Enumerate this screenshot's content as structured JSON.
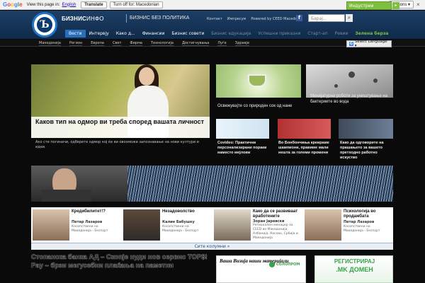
{
  "translate_bar": {
    "logo": [
      "G",
      "o",
      "o",
      "g",
      "l",
      "e"
    ],
    "prompt": "View this page in:",
    "language": "English",
    "translate_button": "Translate",
    "turn_off_button": "Turn off for: Macedonian",
    "options": "Options ▾",
    "close": "×"
  },
  "header": {
    "brand_bold": "БИЗНИС",
    "brand_thin": "ИНФО",
    "tagline": "БИЗНИС БЕЗ ПОЛИТИКА",
    "top_links": [
      "Контакт",
      "Импресум",
      "Powered by CEED Macedonia"
    ],
    "search_placeholder": "Барај...",
    "industry_label": "Индустрии",
    "industry_arrow": "▸",
    "logo_letter": "Ъ"
  },
  "nav": {
    "items": [
      {
        "label": "Вести",
        "style": "active"
      },
      {
        "label": "Интервју",
        "style": "normal"
      },
      {
        "label": "Како д...",
        "style": "normal"
      },
      {
        "label": "Финансии",
        "style": "normal"
      },
      {
        "label": "Бизнис совети",
        "style": "normal"
      },
      {
        "label": "Бизнис едукација",
        "style": "dim"
      },
      {
        "label": "Успешни приказни",
        "style": "dim"
      },
      {
        "label": "Старт-ап",
        "style": "dim"
      },
      {
        "label": "Ревии",
        "style": "dim"
      },
      {
        "label": "Зелена берза",
        "style": "green"
      }
    ]
  },
  "subnav": {
    "items": [
      "Македонија",
      "Регион",
      "Европа",
      "Свет",
      "Фирма",
      "Технологија",
      "Достигнувања",
      "Луѓе",
      "Здравје"
    ],
    "language_select": "Select Language ▾"
  },
  "hero": {
    "title": "Каков тип на одмор ви треба според вашата личност",
    "desc": "Ако сте погиначи, одберете одмор кој ќе ви овозможи запознавање на нови култури и идеи."
  },
  "articles": [
    {
      "title": "Освежувајте со природен сок од нане"
    },
    {
      "title": "Минијатурни роботи за уништување на бактериите во вода"
    },
    {
      "title": "Covideo: Практични персонализирани пораки наместо мејлови"
    },
    {
      "title": "Во Бонбончиња креираме шампиони, правиме мали нешта за големи промени"
    },
    {
      "title": "Како да одговорите на прашањето за вашето претходно работно искуство"
    }
  ],
  "columnists": [
    {
      "topic": "Кредибилитет!?",
      "author": "Петар Лазаров",
      "role": "Косопствени на Македонија - Експорт"
    },
    {
      "topic": "Незадоволство",
      "author": "Калин Бабушку",
      "role": "Косопствени на Македонија - Експорт"
    },
    {
      "topic": "Како да се развиваат вработените",
      "author": "Зоран Јаревски",
      "role": "Регионален менаџер за CEED во Македонија, Албанија, Косово, Србија и Македонија"
    },
    {
      "topic": "Психологија во продажбата",
      "author": "Петар Лазаров",
      "role": "Косопствени на Македонија - Експорт"
    }
  ],
  "columnists_more": "Сите колумни »",
  "bottom": {
    "headline": "Стопанска банка АД – Скопје нуди нов сервис TOP$! Pay – брзи мегусебни плаќања на паметни",
    "ad1_title": "Ваша Визија наши материјали",
    "ad1_brand": "СОЛОПРОМ",
    "ad2_line1": "РЕГИСТРИРАЈ",
    "ad2_line2": ".MK ДОМЕН"
  },
  "colors": {
    "accent_blue": "#2a6fb8",
    "green": "#7fbf3f",
    "facebook": "#3b5998"
  },
  "icons": {
    "search": "search-icon",
    "facebook": "facebook-icon",
    "close": "close-icon"
  }
}
